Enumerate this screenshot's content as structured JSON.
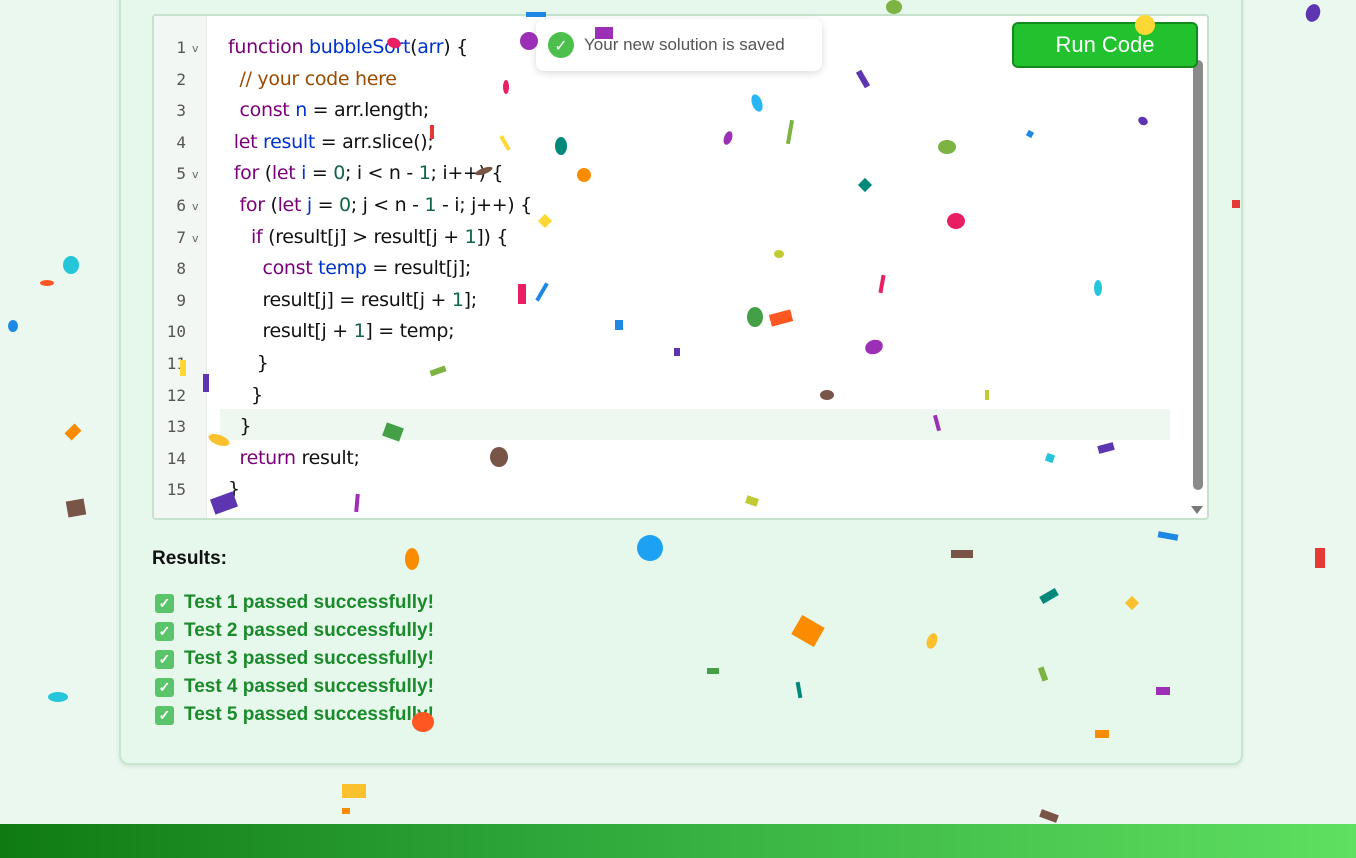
{
  "editor": {
    "line_numbers": [
      "1",
      "2",
      "3",
      "4",
      "5",
      "6",
      "7",
      "8",
      "9",
      "10",
      "11",
      "12",
      "13",
      "14",
      "15"
    ],
    "fold_markers": [
      1,
      5,
      6,
      7
    ],
    "active_line": 13,
    "lines": [
      [
        {
          "t": "function ",
          "c": "kw"
        },
        {
          "t": "bubbleSort",
          "c": "fn"
        },
        {
          "t": "(",
          "c": ""
        },
        {
          "t": "arr",
          "c": "var"
        },
        {
          "t": ") {",
          "c": ""
        }
      ],
      [
        {
          "t": "  ",
          "c": ""
        },
        {
          "t": "// your code here",
          "c": "cm"
        }
      ],
      [
        {
          "t": "  ",
          "c": ""
        },
        {
          "t": "const ",
          "c": "kw"
        },
        {
          "t": "n",
          "c": "var"
        },
        {
          "t": " = arr.length;",
          "c": ""
        }
      ],
      [
        {
          "t": " ",
          "c": ""
        },
        {
          "t": "let ",
          "c": "kw"
        },
        {
          "t": "result",
          "c": "var"
        },
        {
          "t": " = arr.slice();",
          "c": ""
        }
      ],
      [
        {
          "t": " ",
          "c": ""
        },
        {
          "t": "for ",
          "c": "kw"
        },
        {
          "t": "(",
          "c": ""
        },
        {
          "t": "let ",
          "c": "kw"
        },
        {
          "t": "i",
          "c": "var"
        },
        {
          "t": " = ",
          "c": ""
        },
        {
          "t": "0",
          "c": "num"
        },
        {
          "t": "; i < n - ",
          "c": ""
        },
        {
          "t": "1",
          "c": "num"
        },
        {
          "t": "; i++) {",
          "c": ""
        }
      ],
      [
        {
          "t": "  ",
          "c": ""
        },
        {
          "t": "for ",
          "c": "kw"
        },
        {
          "t": "(",
          "c": ""
        },
        {
          "t": "let ",
          "c": "kw"
        },
        {
          "t": "j",
          "c": "var"
        },
        {
          "t": " = ",
          "c": ""
        },
        {
          "t": "0",
          "c": "num"
        },
        {
          "t": "; j < n - ",
          "c": ""
        },
        {
          "t": "1",
          "c": "num"
        },
        {
          "t": " - i; j++) {",
          "c": ""
        }
      ],
      [
        {
          "t": "    ",
          "c": ""
        },
        {
          "t": "if ",
          "c": "kw"
        },
        {
          "t": "(result[j] > result[j + ",
          "c": ""
        },
        {
          "t": "1",
          "c": "num"
        },
        {
          "t": "]) {",
          "c": ""
        }
      ],
      [
        {
          "t": "      ",
          "c": ""
        },
        {
          "t": "const ",
          "c": "kw"
        },
        {
          "t": "temp",
          "c": "var"
        },
        {
          "t": " = result[j];",
          "c": ""
        }
      ],
      [
        {
          "t": "      ",
          "c": ""
        },
        {
          "t": "result[j] = result[j + ",
          "c": ""
        },
        {
          "t": "1",
          "c": "num"
        },
        {
          "t": "];",
          "c": ""
        }
      ],
      [
        {
          "t": "      ",
          "c": ""
        },
        {
          "t": "result[j + ",
          "c": ""
        },
        {
          "t": "1",
          "c": "num"
        },
        {
          "t": "] = temp;",
          "c": ""
        }
      ],
      [
        {
          "t": "     }",
          "c": ""
        }
      ],
      [
        {
          "t": "    }",
          "c": ""
        }
      ],
      [
        {
          "t": "  }",
          "c": ""
        }
      ],
      [
        {
          "t": "  ",
          "c": ""
        },
        {
          "t": "return ",
          "c": "kw"
        },
        {
          "t": "result;",
          "c": ""
        }
      ],
      [
        {
          "t": "}",
          "c": ""
        }
      ]
    ]
  },
  "run_button": {
    "label": "Run Code"
  },
  "toast": {
    "message": "Your new solution is saved",
    "icon": "check-circle-icon"
  },
  "results": {
    "title": "Results:",
    "items": [
      "Test 1 passed successfully!",
      "Test 2 passed successfully!",
      "Test 3 passed successfully!",
      "Test 4 passed successfully!",
      "Test 5 passed successfully!"
    ]
  },
  "colors": {
    "run_button": "#22c22e",
    "success_text": "#1a8a2a",
    "footer_start": "#0f7a12",
    "footer_end": "#5fe060"
  }
}
